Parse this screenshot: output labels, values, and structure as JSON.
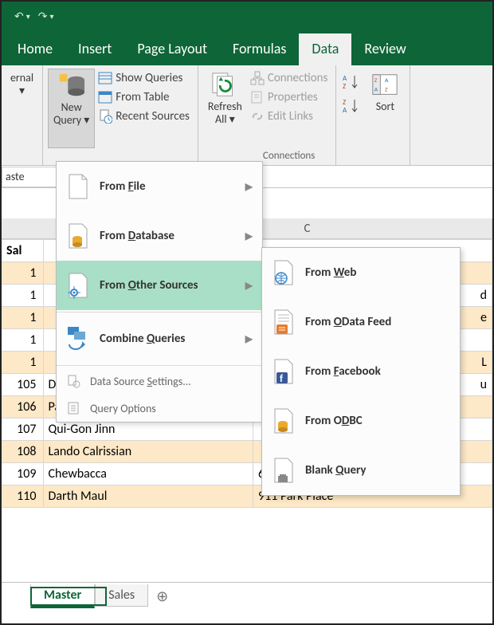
{
  "qat": {
    "undo": "↶",
    "redo": "↷"
  },
  "tabs": [
    "Home",
    "Insert",
    "Page Layout",
    "Formulas",
    "Data",
    "Review"
  ],
  "active_tab": "Data",
  "ribbon": {
    "external_label": "ernal",
    "new_query": {
      "l1": "New",
      "l2": "Query"
    },
    "show_queries": "Show Queries",
    "from_table": "From Table",
    "recent_sources": "Recent Sources",
    "refresh": {
      "l1": "Refresh",
      "l2": "All"
    },
    "connections": "Connections",
    "properties": "Properties",
    "edit_links": "Edit Links",
    "group_connections": "Connections",
    "sort": "Sort"
  },
  "formula_bar": {
    "name_box": "aste"
  },
  "menu": {
    "from_file": "From File",
    "from_database": "From Database",
    "from_other": "From Other Sources",
    "combine": "Combine Queries",
    "dss": "Data Source Settings...",
    "qopts": "Query Options"
  },
  "menu_ak": {
    "file": "F",
    "db": "D",
    "other": "O",
    "combine": "Q",
    "dss": "S",
    "qopts": ""
  },
  "submenu": {
    "web": "From Web",
    "web_ak": "W",
    "odata": "From OData Feed",
    "odata_ak": "O",
    "fb": "From Facebook",
    "fb_ak": "F",
    "odbc": "From ODBC",
    "odbc_ak": "D",
    "blank": "Blank Query",
    "blank_ak": "Q"
  },
  "grid": {
    "col_c": "C",
    "hdr_a": "Sal",
    "rows": [
      {
        "a": "1",
        "b": "",
        "c": ""
      },
      {
        "a": "1",
        "b": "",
        "c": "d"
      },
      {
        "a": "1",
        "b": "",
        "c": "e"
      },
      {
        "a": "1",
        "b": "",
        "c": ""
      },
      {
        "a": "1",
        "b": "",
        "c": "L"
      },
      {
        "a": "105",
        "b": "Darth Vader",
        "c": "u"
      },
      {
        "a": "106",
        "b": "Padme Amidala Skyw",
        "c": ""
      },
      {
        "a": "107",
        "b": "Qui-Gon Jinn",
        "c": ""
      },
      {
        "a": "108",
        "b": "Lando Calrissian",
        "c": ""
      },
      {
        "a": "109",
        "b": "Chewbacca",
        "c": "698 Mayhew Circl"
      },
      {
        "a": "110",
        "b": "Darth Maul",
        "c": "911 Park Place"
      }
    ]
  },
  "sheets": {
    "active": "Master",
    "other": "Sales"
  }
}
